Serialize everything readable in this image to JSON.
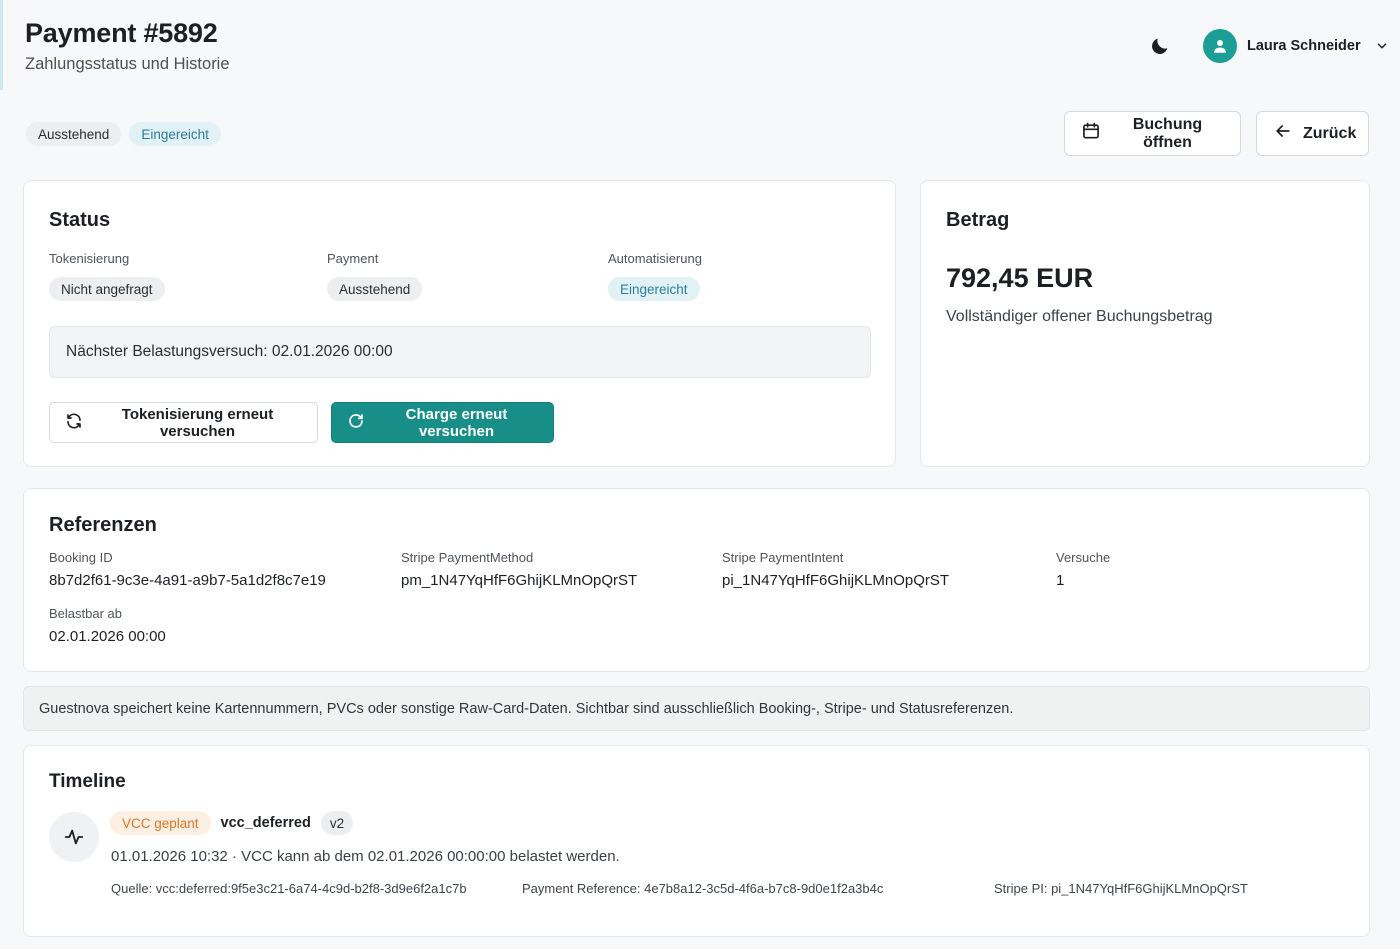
{
  "header": {
    "title": "Payment #5892",
    "subtitle": "Zahlungsstatus und Historie",
    "user_name": "Laura Schneider"
  },
  "top_badges": [
    "Ausstehend",
    "Eingereicht"
  ],
  "actions": {
    "open_booking": "Buchung öffnen",
    "back": "Zurück"
  },
  "status": {
    "title": "Status",
    "tokenization_label": "Tokenisierung",
    "tokenization_value": "Nicht angefragt",
    "payment_label": "Payment",
    "payment_value": "Ausstehend",
    "automation_label": "Automatisierung",
    "automation_value": "Eingereicht",
    "next_attempt": "Nächster Belastungsversuch: 02.01.2026 00:00",
    "retry_tokenization": "Tokenisierung erneut versuchen",
    "retry_charge": "Charge erneut versuchen"
  },
  "amount": {
    "title": "Betrag",
    "value": "792,45 EUR",
    "description": "Vollständiger offener Buchungsbetrag"
  },
  "references": {
    "title": "Referenzen",
    "booking_id_label": "Booking ID",
    "booking_id": "8b7d2f61-9c3e-4a91-a9b7-5a1d2f8c7e19",
    "payment_method_label": "Stripe PaymentMethod",
    "payment_method": "pm_1N47YqHfF6GhijKLMnOpQrST",
    "payment_intent_label": "Stripe PaymentIntent",
    "payment_intent": "pi_1N47YqHfF6GhijKLMnOpQrST",
    "attempts_label": "Versuche",
    "attempts": "1",
    "chargeable_from_label": "Belastbar ab",
    "chargeable_from": "02.01.2026 00:00"
  },
  "notice": "Guestnova speichert keine Kartennummern, PVCs oder sonstige Raw-Card-Daten. Sichtbar sind ausschließlich Booking-, Stripe- und Statusreferenzen.",
  "timeline": {
    "title": "Timeline",
    "entries": [
      {
        "badge": "VCC geplant",
        "event": "vcc_deferred",
        "version": "v2",
        "line": "01.01.2026 10:32 · VCC kann ab dem 02.01.2026 00:00:00 belastet werden.",
        "source": "Quelle: vcc:deferred:9f5e3c21-6a74-4c9d-b2f8-3d9e6f2a1c7b",
        "payment_reference": "Payment Reference: 4e7b8a12-3c5d-4f6a-b7c8-9d0e1f2a3b4c",
        "stripe_pi": "Stripe PI: pi_1N47YqHfF6GhijKLMnOpQrST"
      }
    ]
  },
  "colors": {
    "accent": "#178f88",
    "avatar": "#1b9e96",
    "info_badge_text": "#2a7e9a",
    "warning_badge_text": "#d9761f"
  },
  "icons": [
    "moon-icon",
    "user-icon",
    "chevron-down-icon",
    "calendar-icon",
    "arrow-left-icon",
    "refresh-icon",
    "activity-icon"
  ]
}
